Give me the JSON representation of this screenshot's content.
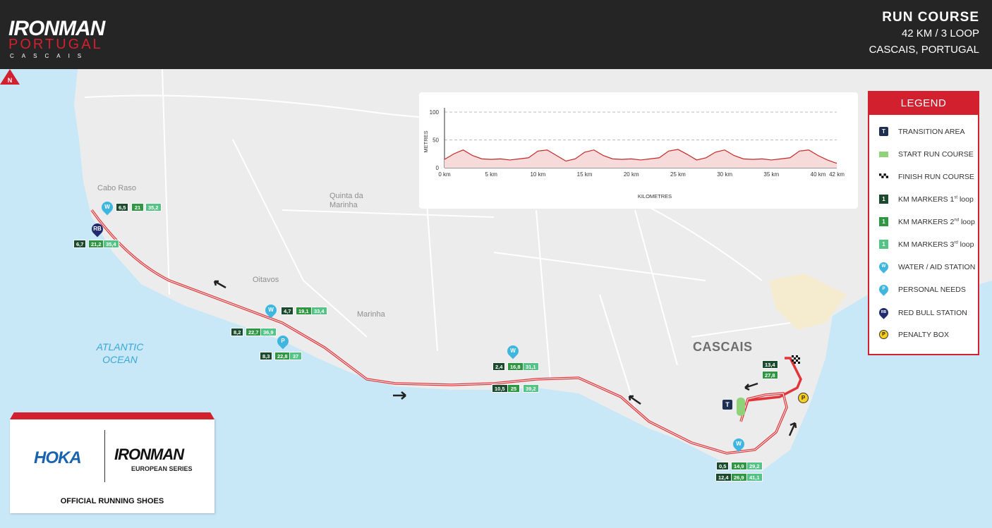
{
  "header": {
    "logo_main": "IRONMAN",
    "logo_sub": "PORTUGAL",
    "logo_city": "CASCAIS",
    "course_title": "RUN COURSE",
    "course_distance": "42 KM / 3 LOOP",
    "course_location": "CASCAIS, PORTUGAL"
  },
  "map": {
    "north_label": "N",
    "places": {
      "cabo_raso": "Cabo Raso",
      "quinta_line1": "Quinta da",
      "quinta_line2": "Marinha",
      "oitavos": "Oitavos",
      "marinha": "Marinha",
      "cascais": "CASCAIS",
      "ocean_line1": "ATLANTIC",
      "ocean_line2": "OCEAN"
    },
    "km_markers": {
      "a1": "6,5",
      "a2": "21",
      "a3": "35,2",
      "b1": "6,7",
      "b2": "21,2",
      "b3": "35,4",
      "c1": "4,7",
      "c2": "19,1",
      "c3": "33,4",
      "d1": "8,2",
      "d2": "22,7",
      "d3": "36,9",
      "e1": "8,3",
      "e2": "22,8",
      "e3": "37",
      "f1": "2,4",
      "f2": "16,8",
      "f3": "31,1",
      "g1": "10,5",
      "g2": "25",
      "g3": "39,2",
      "h1": "13,4",
      "h2": "27,8",
      "i1": "0,5",
      "i2": "14,9",
      "i3": "29,2",
      "j1": "12,4",
      "j2": "26,9",
      "j3": "41,1"
    },
    "symbols": {
      "water": "W",
      "personal": "P",
      "redbull": "RB",
      "transition": "T",
      "penalty": "P"
    }
  },
  "profile": {
    "y_axis_label": "METRES",
    "x_axis_label": "KILOMETRES",
    "y_ticks": [
      "100",
      "50",
      "0"
    ],
    "x_ticks": [
      "0 km",
      "5 km",
      "10 km",
      "15 km",
      "20 km",
      "25 km",
      "30 km",
      "35 km",
      "40 km",
      "42 km"
    ]
  },
  "chart_data": {
    "type": "area",
    "xlabel": "KILOMETRES",
    "ylabel": "METRES",
    "ylim": [
      0,
      100
    ],
    "xlim": [
      0,
      42
    ],
    "x": [
      0,
      1,
      2,
      3,
      4,
      5,
      6,
      7,
      8,
      9,
      10,
      11,
      12,
      13,
      14,
      15,
      16,
      17,
      18,
      19,
      20,
      21,
      22,
      23,
      24,
      25,
      26,
      27,
      28,
      29,
      30,
      31,
      32,
      33,
      34,
      35,
      36,
      37,
      38,
      39,
      40,
      41,
      42
    ],
    "y": [
      15,
      25,
      32,
      22,
      16,
      15,
      16,
      14,
      16,
      18,
      30,
      32,
      22,
      12,
      16,
      28,
      32,
      22,
      16,
      15,
      16,
      14,
      16,
      18,
      30,
      33,
      24,
      14,
      18,
      28,
      32,
      22,
      16,
      15,
      16,
      14,
      16,
      18,
      30,
      32,
      22,
      14,
      8
    ],
    "grid": true,
    "area_color": "#f7dada",
    "line_color": "#c62828"
  },
  "legend": {
    "title": "LEGEND",
    "items": [
      {
        "symbol": "T",
        "label": "TRANSITION AREA"
      },
      {
        "symbol": "",
        "label": "START RUN COURSE"
      },
      {
        "symbol": "",
        "label": "FINISH RUN COURSE"
      },
      {
        "symbol": "1",
        "label_pre": "KM MARKERS 1",
        "label_sup": "st",
        "label_post": " loop"
      },
      {
        "symbol": "1",
        "label_pre": "KM MARKERS 2",
        "label_sup": "nd",
        "label_post": " loop"
      },
      {
        "symbol": "1",
        "label_pre": "KM MARKERS 3",
        "label_sup": "rd",
        "label_post": " loop"
      },
      {
        "symbol": "W",
        "label": "WATER / AID STATION"
      },
      {
        "symbol": "P",
        "label": "PERSONAL NEEDS"
      },
      {
        "symbol": "RB",
        "label": "RED BULL STATION"
      },
      {
        "symbol": "P",
        "label": "PENALTY BOX"
      }
    ]
  },
  "sponsor": {
    "brand1": "HOKA",
    "brand2": "IRONMAN",
    "brand2_sub": "EUROPEAN SERIES",
    "caption": "OFFICIAL RUNNING SHOES"
  },
  "colors": {
    "header_bg": "#252525",
    "brand_red": "#d3202f",
    "ocean": "#c8e8f7",
    "land": "#ececec",
    "route": "#e1353a",
    "loop1": "#1b4a2e",
    "loop2": "#2f9742",
    "loop3": "#54c486"
  }
}
